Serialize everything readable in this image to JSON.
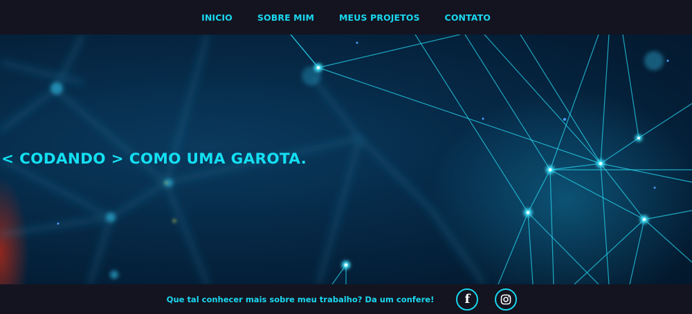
{
  "nav": {
    "items": [
      {
        "label": "INICIO"
      },
      {
        "label": "SOBRE MIM"
      },
      {
        "label": "MEUS PROJETOS"
      },
      {
        "label": "CONTATO"
      }
    ]
  },
  "hero": {
    "title": "< CODANDO > COMO UMA GAROTA."
  },
  "footer": {
    "text": "Que tal conhecer mais sobre meu trabalho? Da um confere!",
    "social": [
      {
        "icon": "facebook-icon"
      },
      {
        "icon": "instagram-icon"
      }
    ]
  },
  "colors": {
    "accent": "#19d8f0",
    "bar_background": "#141420",
    "hero_background": "#062a48"
  }
}
